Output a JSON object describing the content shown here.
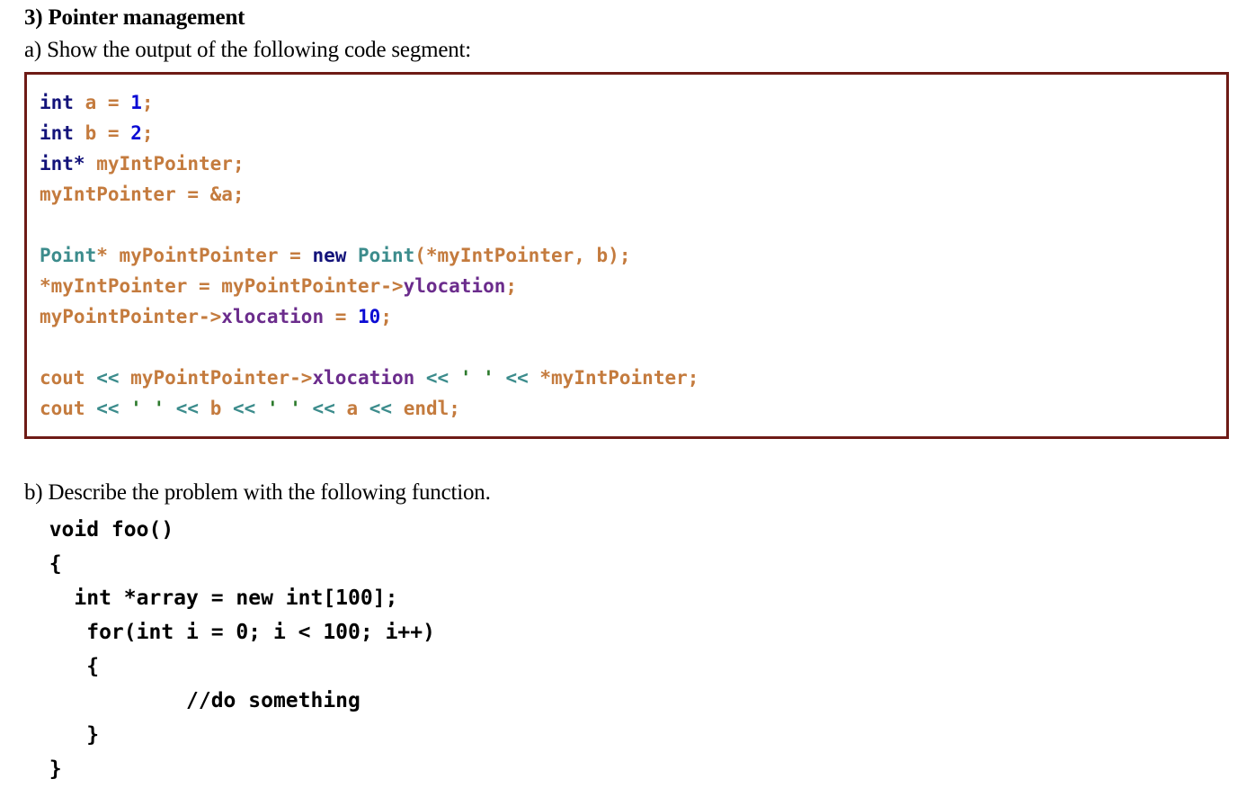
{
  "document": {
    "title": "3) Pointer management",
    "part_a_prompt": "a) Show the output of the following code segment:",
    "part_b_prompt": "b) Describe the problem with the following function."
  },
  "colors": {
    "frame_border": "#6E1B16",
    "keyword": "#13137A",
    "number": "#0B0BD4",
    "identifier": "#C47B3E",
    "type": "#3C8C8C",
    "member": "#6B2C8C",
    "string": "#2C7A2C",
    "background": "#FFFFFF",
    "text": "#000000"
  },
  "code_block_a": {
    "language": "cpp",
    "lines": [
      "int a = 1;",
      "int b = 2;",
      "int* myIntPointer;",
      "myIntPointer = &a;",
      "",
      "Point* myPointPointer = new Point(*myIntPointer, b);",
      "*myIntPointer = myPointPointer->ylocation;",
      "myPointPointer->xlocation = 10;",
      "",
      "cout << myPointPointer->xlocation << ' ' << *myIntPointer;",
      "cout << ' ' << b << ' ' << a << endl;"
    ],
    "tokens": [
      [
        {
          "t": "int",
          "c": "kw"
        },
        {
          "t": " ",
          "c": "id"
        },
        {
          "t": "a",
          "c": "id"
        },
        {
          "t": " ",
          "c": "id"
        },
        {
          "t": "=",
          "c": "id"
        },
        {
          "t": " ",
          "c": "id"
        },
        {
          "t": "1",
          "c": "num"
        },
        {
          "t": ";",
          "c": "id"
        }
      ],
      [
        {
          "t": "int",
          "c": "kw"
        },
        {
          "t": " ",
          "c": "id"
        },
        {
          "t": "b",
          "c": "id"
        },
        {
          "t": " ",
          "c": "id"
        },
        {
          "t": "=",
          "c": "id"
        },
        {
          "t": " ",
          "c": "id"
        },
        {
          "t": "2",
          "c": "num"
        },
        {
          "t": ";",
          "c": "id"
        }
      ],
      [
        {
          "t": "int*",
          "c": "kw"
        },
        {
          "t": " ",
          "c": "id"
        },
        {
          "t": "myIntPointer;",
          "c": "id"
        }
      ],
      [
        {
          "t": "myIntPointer = &a;",
          "c": "id"
        }
      ],
      [],
      [
        {
          "t": "Point",
          "c": "type"
        },
        {
          "t": "* myPointPointer = ",
          "c": "id"
        },
        {
          "t": "new",
          "c": "kw"
        },
        {
          "t": " ",
          "c": "id"
        },
        {
          "t": "Point",
          "c": "type"
        },
        {
          "t": "(*myIntPointer, b);",
          "c": "id"
        }
      ],
      [
        {
          "t": "*myIntPointer = myPointPointer->",
          "c": "id"
        },
        {
          "t": "ylocation",
          "c": "member"
        },
        {
          "t": ";",
          "c": "id"
        }
      ],
      [
        {
          "t": "myPointPointer->",
          "c": "id"
        },
        {
          "t": "xlocation",
          "c": "member"
        },
        {
          "t": " = ",
          "c": "id"
        },
        {
          "t": "10",
          "c": "num"
        },
        {
          "t": ";",
          "c": "id"
        }
      ],
      [],
      [
        {
          "t": "cout ",
          "c": "id"
        },
        {
          "t": "<<",
          "c": "type"
        },
        {
          "t": " myPointPointer->",
          "c": "id"
        },
        {
          "t": "xlocation",
          "c": "member"
        },
        {
          "t": " ",
          "c": "id"
        },
        {
          "t": "<<",
          "c": "type"
        },
        {
          "t": " ",
          "c": "id"
        },
        {
          "t": "' '",
          "c": "str"
        },
        {
          "t": " ",
          "c": "id"
        },
        {
          "t": "<<",
          "c": "type"
        },
        {
          "t": " *myIntPointer;",
          "c": "id"
        }
      ],
      [
        {
          "t": "cout ",
          "c": "id"
        },
        {
          "t": "<<",
          "c": "type"
        },
        {
          "t": " ",
          "c": "id"
        },
        {
          "t": "' '",
          "c": "str"
        },
        {
          "t": " ",
          "c": "id"
        },
        {
          "t": "<<",
          "c": "type"
        },
        {
          "t": " b ",
          "c": "id"
        },
        {
          "t": "<<",
          "c": "type"
        },
        {
          "t": " ",
          "c": "id"
        },
        {
          "t": "' '",
          "c": "str"
        },
        {
          "t": " ",
          "c": "id"
        },
        {
          "t": "<<",
          "c": "type"
        },
        {
          "t": " a ",
          "c": "id"
        },
        {
          "t": "<<",
          "c": "type"
        },
        {
          "t": " endl;",
          "c": "id"
        }
      ]
    ]
  },
  "code_block_b": {
    "language": "cpp",
    "lines": [
      "  void foo()",
      "  {",
      "    int *array = new int[100];",
      "     for(int i = 0; i < 100; i++)",
      "     {",
      "             //do something",
      "     }",
      "  }"
    ]
  }
}
